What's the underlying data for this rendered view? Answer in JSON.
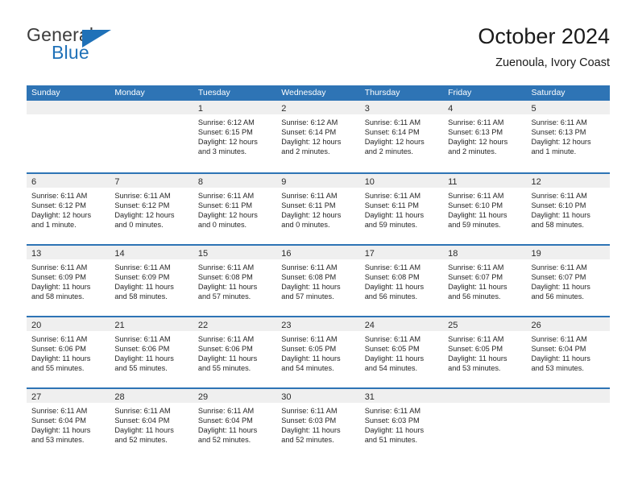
{
  "brand": {
    "name_top": "General",
    "name_bottom": "Blue",
    "accent_color": "#1f71b8",
    "logo_icon": "triangle-icon"
  },
  "header": {
    "title": "October 2024",
    "subtitle": "Zuenoula, Ivory Coast"
  },
  "theme": {
    "header_blue": "#2e74b5",
    "daynum_band": "#efefef",
    "text": "#262626"
  },
  "weekdays": [
    "Sunday",
    "Monday",
    "Tuesday",
    "Wednesday",
    "Thursday",
    "Friday",
    "Saturday"
  ],
  "weeks": [
    [
      {
        "day": "",
        "lines": []
      },
      {
        "day": "",
        "lines": []
      },
      {
        "day": "1",
        "lines": [
          "Sunrise: 6:12 AM",
          "Sunset: 6:15 PM",
          "Daylight: 12 hours",
          "and 3 minutes."
        ]
      },
      {
        "day": "2",
        "lines": [
          "Sunrise: 6:12 AM",
          "Sunset: 6:14 PM",
          "Daylight: 12 hours",
          "and 2 minutes."
        ]
      },
      {
        "day": "3",
        "lines": [
          "Sunrise: 6:11 AM",
          "Sunset: 6:14 PM",
          "Daylight: 12 hours",
          "and 2 minutes."
        ]
      },
      {
        "day": "4",
        "lines": [
          "Sunrise: 6:11 AM",
          "Sunset: 6:13 PM",
          "Daylight: 12 hours",
          "and 2 minutes."
        ]
      },
      {
        "day": "5",
        "lines": [
          "Sunrise: 6:11 AM",
          "Sunset: 6:13 PM",
          "Daylight: 12 hours",
          "and 1 minute."
        ]
      }
    ],
    [
      {
        "day": "6",
        "lines": [
          "Sunrise: 6:11 AM",
          "Sunset: 6:12 PM",
          "Daylight: 12 hours",
          "and 1 minute."
        ]
      },
      {
        "day": "7",
        "lines": [
          "Sunrise: 6:11 AM",
          "Sunset: 6:12 PM",
          "Daylight: 12 hours",
          "and 0 minutes."
        ]
      },
      {
        "day": "8",
        "lines": [
          "Sunrise: 6:11 AM",
          "Sunset: 6:11 PM",
          "Daylight: 12 hours",
          "and 0 minutes."
        ]
      },
      {
        "day": "9",
        "lines": [
          "Sunrise: 6:11 AM",
          "Sunset: 6:11 PM",
          "Daylight: 12 hours",
          "and 0 minutes."
        ]
      },
      {
        "day": "10",
        "lines": [
          "Sunrise: 6:11 AM",
          "Sunset: 6:11 PM",
          "Daylight: 11 hours",
          "and 59 minutes."
        ]
      },
      {
        "day": "11",
        "lines": [
          "Sunrise: 6:11 AM",
          "Sunset: 6:10 PM",
          "Daylight: 11 hours",
          "and 59 minutes."
        ]
      },
      {
        "day": "12",
        "lines": [
          "Sunrise: 6:11 AM",
          "Sunset: 6:10 PM",
          "Daylight: 11 hours",
          "and 58 minutes."
        ]
      }
    ],
    [
      {
        "day": "13",
        "lines": [
          "Sunrise: 6:11 AM",
          "Sunset: 6:09 PM",
          "Daylight: 11 hours",
          "and 58 minutes."
        ]
      },
      {
        "day": "14",
        "lines": [
          "Sunrise: 6:11 AM",
          "Sunset: 6:09 PM",
          "Daylight: 11 hours",
          "and 58 minutes."
        ]
      },
      {
        "day": "15",
        "lines": [
          "Sunrise: 6:11 AM",
          "Sunset: 6:08 PM",
          "Daylight: 11 hours",
          "and 57 minutes."
        ]
      },
      {
        "day": "16",
        "lines": [
          "Sunrise: 6:11 AM",
          "Sunset: 6:08 PM",
          "Daylight: 11 hours",
          "and 57 minutes."
        ]
      },
      {
        "day": "17",
        "lines": [
          "Sunrise: 6:11 AM",
          "Sunset: 6:08 PM",
          "Daylight: 11 hours",
          "and 56 minutes."
        ]
      },
      {
        "day": "18",
        "lines": [
          "Sunrise: 6:11 AM",
          "Sunset: 6:07 PM",
          "Daylight: 11 hours",
          "and 56 minutes."
        ]
      },
      {
        "day": "19",
        "lines": [
          "Sunrise: 6:11 AM",
          "Sunset: 6:07 PM",
          "Daylight: 11 hours",
          "and 56 minutes."
        ]
      }
    ],
    [
      {
        "day": "20",
        "lines": [
          "Sunrise: 6:11 AM",
          "Sunset: 6:06 PM",
          "Daylight: 11 hours",
          "and 55 minutes."
        ]
      },
      {
        "day": "21",
        "lines": [
          "Sunrise: 6:11 AM",
          "Sunset: 6:06 PM",
          "Daylight: 11 hours",
          "and 55 minutes."
        ]
      },
      {
        "day": "22",
        "lines": [
          "Sunrise: 6:11 AM",
          "Sunset: 6:06 PM",
          "Daylight: 11 hours",
          "and 55 minutes."
        ]
      },
      {
        "day": "23",
        "lines": [
          "Sunrise: 6:11 AM",
          "Sunset: 6:05 PM",
          "Daylight: 11 hours",
          "and 54 minutes."
        ]
      },
      {
        "day": "24",
        "lines": [
          "Sunrise: 6:11 AM",
          "Sunset: 6:05 PM",
          "Daylight: 11 hours",
          "and 54 minutes."
        ]
      },
      {
        "day": "25",
        "lines": [
          "Sunrise: 6:11 AM",
          "Sunset: 6:05 PM",
          "Daylight: 11 hours",
          "and 53 minutes."
        ]
      },
      {
        "day": "26",
        "lines": [
          "Sunrise: 6:11 AM",
          "Sunset: 6:04 PM",
          "Daylight: 11 hours",
          "and 53 minutes."
        ]
      }
    ],
    [
      {
        "day": "27",
        "lines": [
          "Sunrise: 6:11 AM",
          "Sunset: 6:04 PM",
          "Daylight: 11 hours",
          "and 53 minutes."
        ]
      },
      {
        "day": "28",
        "lines": [
          "Sunrise: 6:11 AM",
          "Sunset: 6:04 PM",
          "Daylight: 11 hours",
          "and 52 minutes."
        ]
      },
      {
        "day": "29",
        "lines": [
          "Sunrise: 6:11 AM",
          "Sunset: 6:04 PM",
          "Daylight: 11 hours",
          "and 52 minutes."
        ]
      },
      {
        "day": "30",
        "lines": [
          "Sunrise: 6:11 AM",
          "Sunset: 6:03 PM",
          "Daylight: 11 hours",
          "and 52 minutes."
        ]
      },
      {
        "day": "31",
        "lines": [
          "Sunrise: 6:11 AM",
          "Sunset: 6:03 PM",
          "Daylight: 11 hours",
          "and 51 minutes."
        ]
      },
      {
        "day": "",
        "lines": []
      },
      {
        "day": "",
        "lines": []
      }
    ]
  ]
}
